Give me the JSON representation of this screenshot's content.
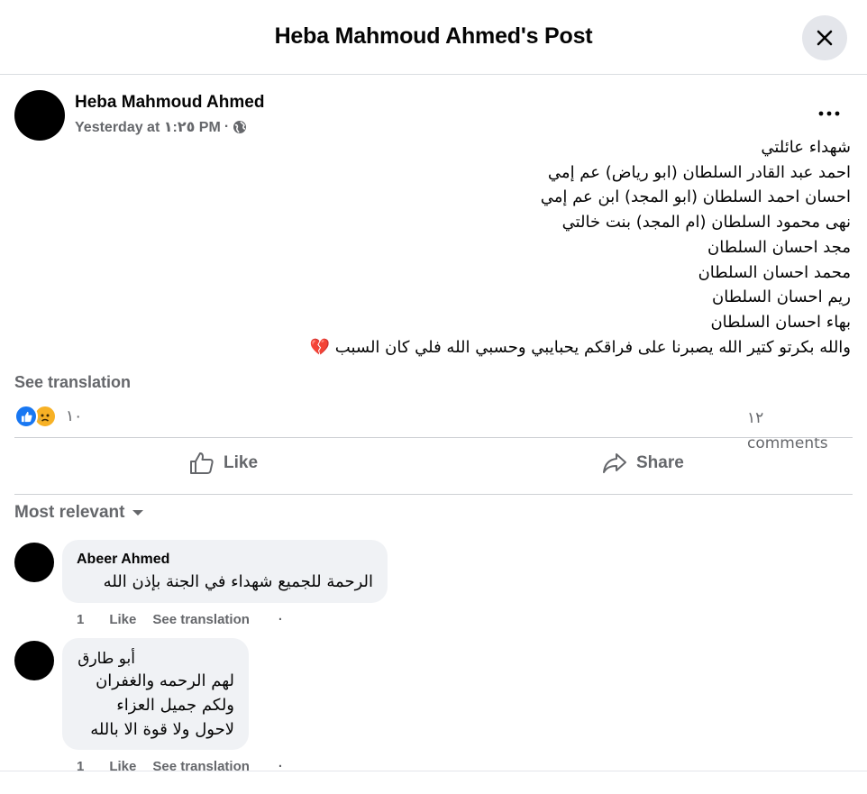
{
  "header": {
    "title": "Heba Mahmoud Ahmed's Post"
  },
  "post": {
    "author": "Heba Mahmoud Ahmed",
    "time": "Yesterday at ١:٢٥ PM",
    "separator": "·",
    "lines": [
      "شهداء عائلتي",
      "احمد عبد القادر السلطان (ابو رياض) عم إمي",
      "احسان احمد السلطان (ابو المجد) ابن عم إمي",
      "نهى محمود السلطان (ام المجد) بنت خالتي",
      "مجد احسان السلطان",
      "محمد احسان السلطان",
      "ريم احسان السلطان",
      "بهاء احسان السلطان",
      "والله بكرتو كتير الله يصبرنا على فراقكم يحبايبي وحسبي الله فلي كان السبب 💔"
    ],
    "see_translation": "See translation",
    "reaction_count": "١٠",
    "comments_count": "١٢ comments"
  },
  "actions": {
    "like": "Like",
    "share": "Share"
  },
  "sort": {
    "label": "Most relevant"
  },
  "comments": [
    {
      "author": "Abeer Ahmed",
      "text": "الرحمة للجميع شهداء في الجنة بإذن الله",
      "time": "1",
      "like": "Like",
      "translate": "See translation",
      "dot": "·"
    },
    {
      "author": "أبو طارق",
      "lines": [
        "لهم الرحمه والغفران",
        "ولكم جميل العزاء",
        "لاحول ولا قوة الا بالله"
      ],
      "time": "1",
      "like": "Like",
      "translate": "See translation",
      "dot": "·"
    }
  ],
  "colors": {
    "accent": "#1877f2",
    "muted": "#65676b",
    "bubble": "#f0f2f5",
    "reaction_sad": "#f7b125"
  }
}
